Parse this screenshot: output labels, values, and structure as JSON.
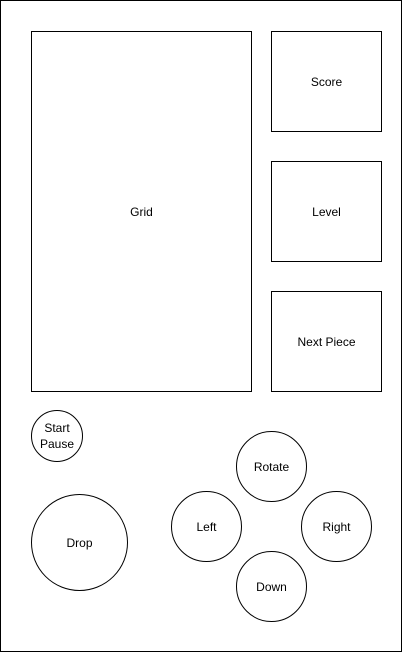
{
  "panels": {
    "grid_label": "Grid",
    "score_label": "Score",
    "level_label": "Level",
    "next_piece_label": "Next Piece"
  },
  "controls": {
    "start_label": "Start",
    "pause_label": "Pause",
    "drop_label": "Drop",
    "rotate_label": "Rotate",
    "left_label": "Left",
    "right_label": "Right",
    "down_label": "Down"
  }
}
